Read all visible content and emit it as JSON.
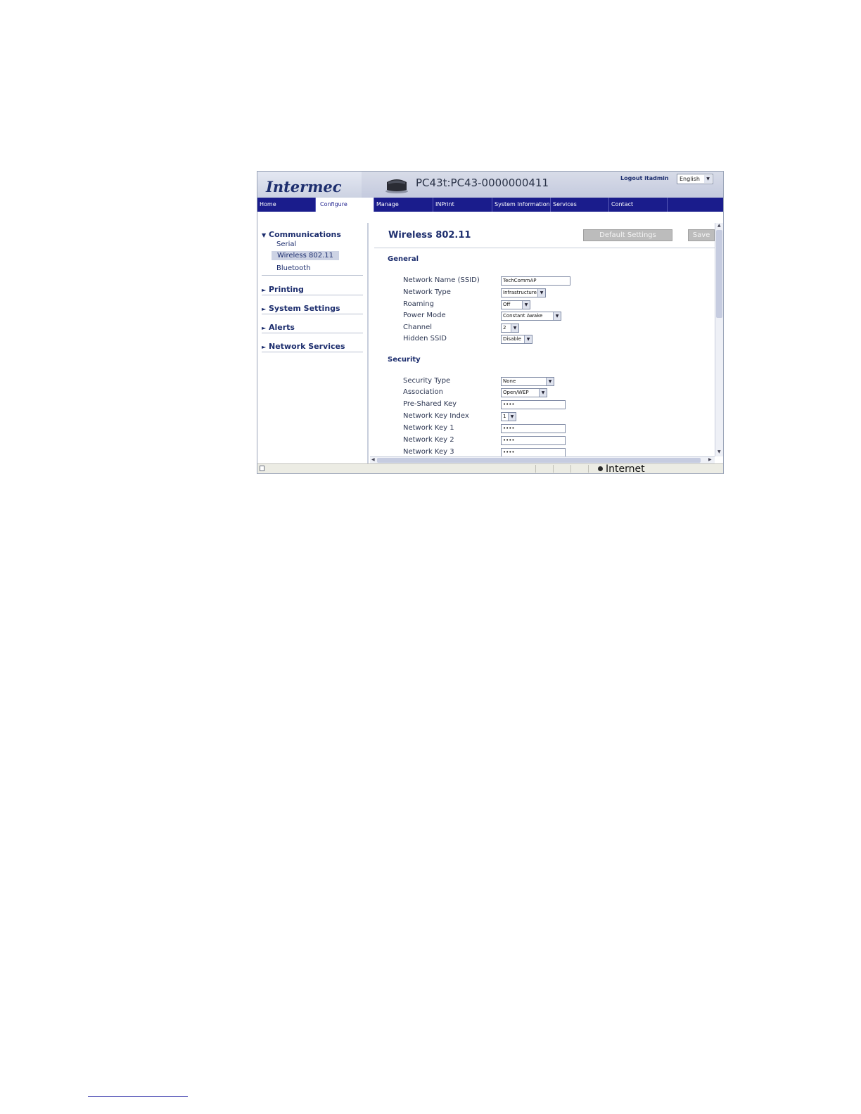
{
  "header": {
    "logo": "Intermec",
    "device_name": "PC43t:PC43-0000000411",
    "logout_text": "Logout itadmin",
    "language": "English"
  },
  "nav": {
    "tabs": [
      {
        "label": "Home"
      },
      {
        "label": "Configure",
        "active": true
      },
      {
        "label": "Manage"
      },
      {
        "label": "INPrint"
      },
      {
        "label": "System Information"
      },
      {
        "label": "Services"
      },
      {
        "label": "Contact"
      }
    ]
  },
  "sidebar": {
    "groups": [
      {
        "label": "Communications",
        "expanded": true,
        "items": [
          "Serial",
          "Wireless 802.11",
          "Bluetooth"
        ],
        "active_item": "Wireless 802.11"
      },
      {
        "label": "Printing",
        "expanded": false
      },
      {
        "label": "System Settings",
        "expanded": false
      },
      {
        "label": "Alerts",
        "expanded": false
      },
      {
        "label": "Network Services",
        "expanded": false
      }
    ],
    "expanded_marker": "▼",
    "collapsed_marker": "►"
  },
  "content": {
    "title": "Wireless 802.11",
    "default_settings_label": "Default Settings",
    "save_label": "Save",
    "general": {
      "heading": "General",
      "fields": [
        {
          "label": "Network Name (SSID)",
          "value": "TechCommAP",
          "kind": "text"
        },
        {
          "label": "Network Type",
          "value": "Infrastructure",
          "kind": "select"
        },
        {
          "label": "Roaming",
          "value": "Off",
          "kind": "select"
        },
        {
          "label": "Power Mode",
          "value": "Constant Awake",
          "kind": "select"
        },
        {
          "label": "Channel",
          "value": "2",
          "kind": "select"
        },
        {
          "label": "Hidden SSID",
          "value": "Disable",
          "kind": "select"
        }
      ]
    },
    "security": {
      "heading": "Security",
      "fields": [
        {
          "label": "Security Type",
          "value": "None",
          "kind": "select"
        },
        {
          "label": "Association",
          "value": "Open/WEP",
          "kind": "select"
        },
        {
          "label": "Pre-Shared Key",
          "value": "••••",
          "kind": "password"
        },
        {
          "label": "Network Key Index",
          "value": "1",
          "kind": "select"
        },
        {
          "label": "Network Key 1",
          "value": "••••",
          "kind": "password"
        },
        {
          "label": "Network Key 2",
          "value": "••••",
          "kind": "password"
        },
        {
          "label": "Network Key 3",
          "value": "••••",
          "kind": "password"
        }
      ]
    }
  },
  "statusbar": {
    "zone": "Internet"
  },
  "colors": {
    "nav_bg": "#1a1c8c",
    "brand_text": "#1d2e6e",
    "sidebar_active_bg": "#cdd3e4"
  },
  "icons": {
    "printer": "printer-icon",
    "dropdown": "chevron-down-icon",
    "zone": "internet-zone-icon"
  }
}
